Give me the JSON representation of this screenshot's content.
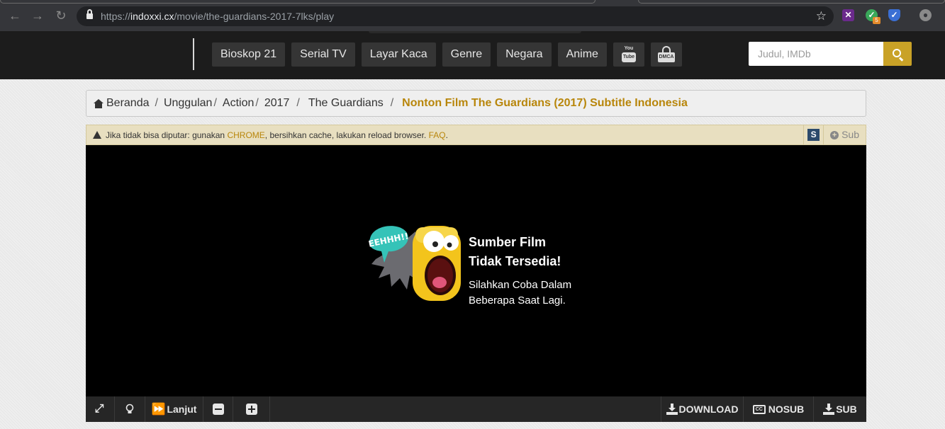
{
  "browser": {
    "url_prefix": "https://",
    "url_host": "indoxxi.cx",
    "url_path": "/movie/the-guardians-2017-7lks/play",
    "extension_badge": "5"
  },
  "header": {
    "nav": [
      {
        "label": "Bioskop 21"
      },
      {
        "label": "Serial TV"
      },
      {
        "label": "Layar Kaca"
      },
      {
        "label": "Genre"
      },
      {
        "label": "Negara"
      },
      {
        "label": "Anime"
      }
    ],
    "youtube_icon_text_top": "You",
    "youtube_icon_text_bottom": "Tube",
    "dmca_icon_text": "DMCA",
    "search_placeholder": "Judul, IMDb",
    "accent_color": "#c9a227"
  },
  "breadcrumb": {
    "items": [
      "Beranda",
      "Unggulan",
      "Action",
      "2017",
      "The Guardians"
    ],
    "current": "Nonton Film The Guardians (2017) Subtitle Indonesia"
  },
  "notice": {
    "text_before": "Jika tidak bisa diputar: gunakan ",
    "chrome": "CHROME",
    "text_middle": ", bersihkan cache, lakukan reload browser. ",
    "faq": "FAQ",
    "text_after": ".",
    "s_button": "S",
    "sub_button": "Sub"
  },
  "player": {
    "mascot_text": "EEHHH!!",
    "title_line1": "Sumber Film",
    "title_line2": "Tidak Tersedia!",
    "sub_line1": "Silahkan Coba Dalam",
    "sub_line2": "Beberapa Saat Lagi."
  },
  "controls": {
    "next_label": "Lanjut",
    "download_label": "DOWNLOAD",
    "nosub_label": "NOSUB",
    "cc_icon_text": "CC",
    "sub_label": "SUB"
  }
}
